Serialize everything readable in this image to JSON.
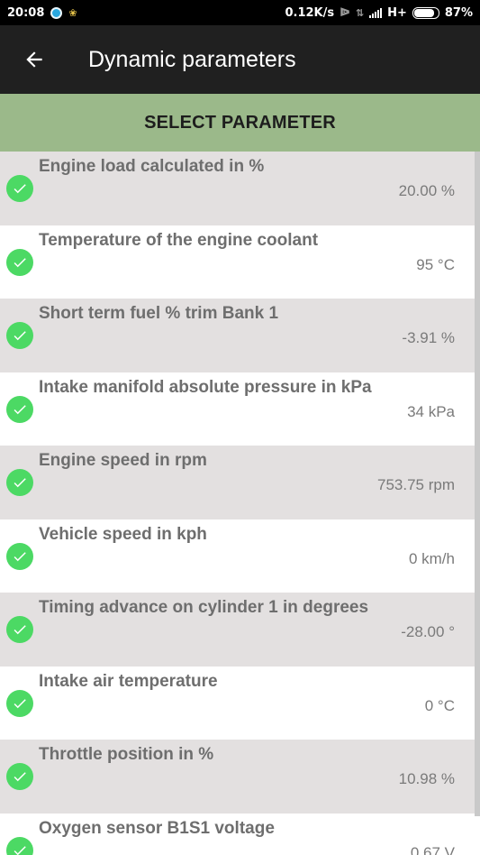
{
  "status_bar": {
    "time": "20:08",
    "network_speed": "0.12K/s",
    "network_type": "H+",
    "battery": "87%",
    "battery_level": 0.87,
    "icons": [
      "app-notification-icon",
      "bird-icon",
      "bluetooth-icon",
      "data-transfer-icon",
      "signal-icon",
      "battery-icon"
    ]
  },
  "app_bar": {
    "title": "Dynamic parameters",
    "back_icon": "arrow-left-icon"
  },
  "select_button": {
    "label": "SELECT PARAMETER",
    "color": "#9bb98a"
  },
  "parameters": [
    {
      "label": "Engine load calculated in %",
      "value": "20.00 %"
    },
    {
      "label": "Temperature of the engine coolant",
      "value": "95 °C"
    },
    {
      "label": "Short term fuel % trim Bank 1",
      "value": "-3.91 %"
    },
    {
      "label": "Intake manifold absolute pressure in kPa",
      "value": "34 kPa"
    },
    {
      "label": "Engine speed in rpm",
      "value": "753.75 rpm"
    },
    {
      "label": "Vehicle speed in kph",
      "value": "0 km/h"
    },
    {
      "label": "Timing advance on cylinder 1 in degrees",
      "value": "-28.00 °"
    },
    {
      "label": "Intake air temperature",
      "value": "0 °C"
    },
    {
      "label": "Throttle position in %",
      "value": "10.98 %"
    },
    {
      "label": "Oxygen sensor B1S1 voltage",
      "value": "0.67 V"
    }
  ],
  "colors": {
    "check": "#4cd964",
    "row_shaded": "#e3e0e0",
    "app_bar": "#202020"
  }
}
